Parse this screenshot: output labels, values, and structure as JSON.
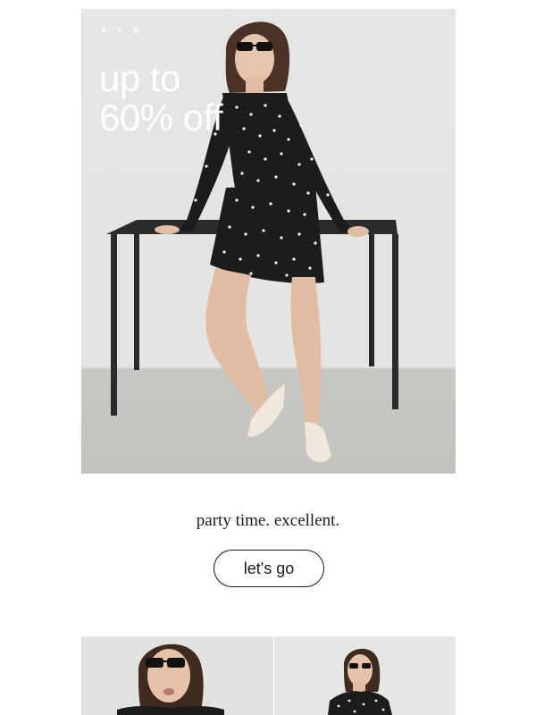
{
  "hero": {
    "brand": "AYR",
    "headline_line1": "up to",
    "headline_line2": "60% off"
  },
  "promo": {
    "tagline": "party time. excellent.",
    "cta_label": "let's go"
  },
  "colors": {
    "background": "#ffffff",
    "wall": "#e5e5e3",
    "floor": "#c4c3c0",
    "dress": "#1c1c1e",
    "text": "#1a1a1a"
  }
}
